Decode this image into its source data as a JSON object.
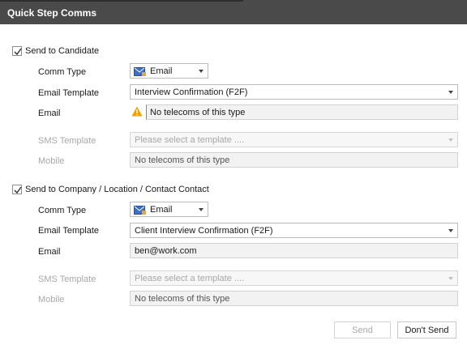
{
  "window": {
    "title": "Quick Step Comms"
  },
  "candidate": {
    "section_label": "Send to Candidate",
    "checked": true,
    "comm_type_label": "Comm Type",
    "comm_type_value": "Email",
    "email_template_label": "Email Template",
    "email_template_value": "Interview Confirmation (F2F)",
    "email_label": "Email",
    "email_value": "No telecoms of this type",
    "sms_template_label": "SMS Template",
    "sms_template_placeholder": "Please select a template ....",
    "mobile_label": "Mobile",
    "mobile_value": "No telecoms of this type"
  },
  "company": {
    "section_label": "Send to Company / Location / Contact Contact",
    "checked": true,
    "comm_type_label": "Comm Type",
    "comm_type_value": "Email",
    "email_template_label": "Email Template",
    "email_template_value": "Client Interview Confirmation (F2F)",
    "email_label": "Email",
    "email_value": "ben@work.com",
    "sms_template_label": "SMS Template",
    "sms_template_placeholder": "Please select a template ....",
    "mobile_label": "Mobile",
    "mobile_value": "No telecoms of this type"
  },
  "footer": {
    "send_label": "Send",
    "dont_send_label": "Don't Send"
  },
  "colors": {
    "titlebar_bg": "#4a4a4a",
    "warning": "#f0a000",
    "email_icon": "#3d6fc4"
  }
}
